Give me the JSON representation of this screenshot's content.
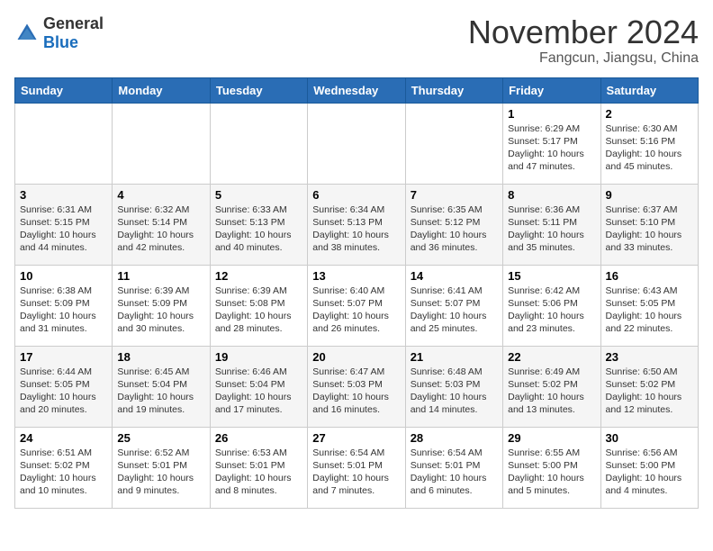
{
  "header": {
    "logo_general": "General",
    "logo_blue": "Blue",
    "month_year": "November 2024",
    "location": "Fangcun, Jiangsu, China"
  },
  "weekdays": [
    "Sunday",
    "Monday",
    "Tuesday",
    "Wednesday",
    "Thursday",
    "Friday",
    "Saturday"
  ],
  "weeks": [
    [
      null,
      null,
      null,
      null,
      null,
      {
        "day": 1,
        "sunrise": "6:29 AM",
        "sunset": "5:17 PM",
        "daylight": "10 hours and 47 minutes."
      },
      {
        "day": 2,
        "sunrise": "6:30 AM",
        "sunset": "5:16 PM",
        "daylight": "10 hours and 45 minutes."
      }
    ],
    [
      {
        "day": 3,
        "sunrise": "6:31 AM",
        "sunset": "5:15 PM",
        "daylight": "10 hours and 44 minutes."
      },
      {
        "day": 4,
        "sunrise": "6:32 AM",
        "sunset": "5:14 PM",
        "daylight": "10 hours and 42 minutes."
      },
      {
        "day": 5,
        "sunrise": "6:33 AM",
        "sunset": "5:13 PM",
        "daylight": "10 hours and 40 minutes."
      },
      {
        "day": 6,
        "sunrise": "6:34 AM",
        "sunset": "5:13 PM",
        "daylight": "10 hours and 38 minutes."
      },
      {
        "day": 7,
        "sunrise": "6:35 AM",
        "sunset": "5:12 PM",
        "daylight": "10 hours and 36 minutes."
      },
      {
        "day": 8,
        "sunrise": "6:36 AM",
        "sunset": "5:11 PM",
        "daylight": "10 hours and 35 minutes."
      },
      {
        "day": 9,
        "sunrise": "6:37 AM",
        "sunset": "5:10 PM",
        "daylight": "10 hours and 33 minutes."
      }
    ],
    [
      {
        "day": 10,
        "sunrise": "6:38 AM",
        "sunset": "5:09 PM",
        "daylight": "10 hours and 31 minutes."
      },
      {
        "day": 11,
        "sunrise": "6:39 AM",
        "sunset": "5:09 PM",
        "daylight": "10 hours and 30 minutes."
      },
      {
        "day": 12,
        "sunrise": "6:39 AM",
        "sunset": "5:08 PM",
        "daylight": "10 hours and 28 minutes."
      },
      {
        "day": 13,
        "sunrise": "6:40 AM",
        "sunset": "5:07 PM",
        "daylight": "10 hours and 26 minutes."
      },
      {
        "day": 14,
        "sunrise": "6:41 AM",
        "sunset": "5:07 PM",
        "daylight": "10 hours and 25 minutes."
      },
      {
        "day": 15,
        "sunrise": "6:42 AM",
        "sunset": "5:06 PM",
        "daylight": "10 hours and 23 minutes."
      },
      {
        "day": 16,
        "sunrise": "6:43 AM",
        "sunset": "5:05 PM",
        "daylight": "10 hours and 22 minutes."
      }
    ],
    [
      {
        "day": 17,
        "sunrise": "6:44 AM",
        "sunset": "5:05 PM",
        "daylight": "10 hours and 20 minutes."
      },
      {
        "day": 18,
        "sunrise": "6:45 AM",
        "sunset": "5:04 PM",
        "daylight": "10 hours and 19 minutes."
      },
      {
        "day": 19,
        "sunrise": "6:46 AM",
        "sunset": "5:04 PM",
        "daylight": "10 hours and 17 minutes."
      },
      {
        "day": 20,
        "sunrise": "6:47 AM",
        "sunset": "5:03 PM",
        "daylight": "10 hours and 16 minutes."
      },
      {
        "day": 21,
        "sunrise": "6:48 AM",
        "sunset": "5:03 PM",
        "daylight": "10 hours and 14 minutes."
      },
      {
        "day": 22,
        "sunrise": "6:49 AM",
        "sunset": "5:02 PM",
        "daylight": "10 hours and 13 minutes."
      },
      {
        "day": 23,
        "sunrise": "6:50 AM",
        "sunset": "5:02 PM",
        "daylight": "10 hours and 12 minutes."
      }
    ],
    [
      {
        "day": 24,
        "sunrise": "6:51 AM",
        "sunset": "5:02 PM",
        "daylight": "10 hours and 10 minutes."
      },
      {
        "day": 25,
        "sunrise": "6:52 AM",
        "sunset": "5:01 PM",
        "daylight": "10 hours and 9 minutes."
      },
      {
        "day": 26,
        "sunrise": "6:53 AM",
        "sunset": "5:01 PM",
        "daylight": "10 hours and 8 minutes."
      },
      {
        "day": 27,
        "sunrise": "6:54 AM",
        "sunset": "5:01 PM",
        "daylight": "10 hours and 7 minutes."
      },
      {
        "day": 28,
        "sunrise": "6:54 AM",
        "sunset": "5:01 PM",
        "daylight": "10 hours and 6 minutes."
      },
      {
        "day": 29,
        "sunrise": "6:55 AM",
        "sunset": "5:00 PM",
        "daylight": "10 hours and 5 minutes."
      },
      {
        "day": 30,
        "sunrise": "6:56 AM",
        "sunset": "5:00 PM",
        "daylight": "10 hours and 4 minutes."
      }
    ]
  ],
  "labels": {
    "sunrise": "Sunrise:",
    "sunset": "Sunset:",
    "daylight": "Daylight:"
  }
}
